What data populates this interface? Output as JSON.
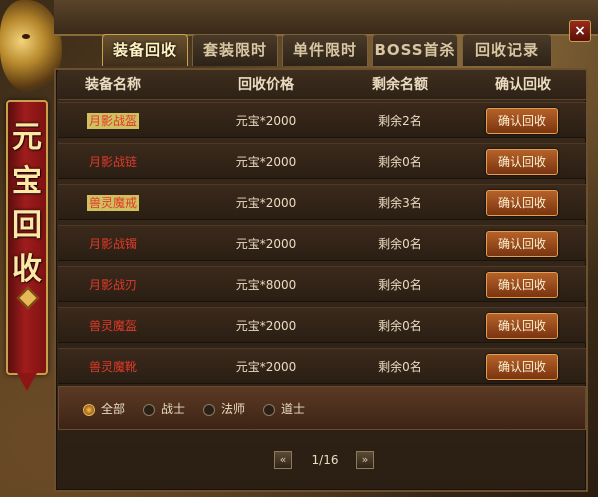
{
  "banner": {
    "title": "元宝回收"
  },
  "tabs": [
    {
      "label": "装备回收"
    },
    {
      "label": "套装限时"
    },
    {
      "label": "单件限时"
    },
    {
      "label": "BOSS首杀"
    },
    {
      "label": "回收记录"
    }
  ],
  "table": {
    "headers": {
      "name": "装备名称",
      "price": "回收价格",
      "remaining": "剩余名额",
      "action": "确认回收"
    },
    "rows": [
      {
        "name": "月影战盔",
        "price": "元宝*2000",
        "remaining": "剩余2名",
        "button": "确认回收",
        "name_style": "hi"
      },
      {
        "name": "月影战链",
        "price": "元宝*2000",
        "remaining": "剩余0名",
        "button": "确认回收",
        "name_style": "red"
      },
      {
        "name": "兽灵魔戒",
        "price": "元宝*2000",
        "remaining": "剩余3名",
        "button": "确认回收",
        "name_style": "hi"
      },
      {
        "name": "月影战镯",
        "price": "元宝*2000",
        "remaining": "剩余0名",
        "button": "确认回收",
        "name_style": "red"
      },
      {
        "name": "月影战刃",
        "price": "元宝*8000",
        "remaining": "剩余0名",
        "button": "确认回收",
        "name_style": "red"
      },
      {
        "name": "兽灵魔盔",
        "price": "元宝*2000",
        "remaining": "剩余0名",
        "button": "确认回收",
        "name_style": "red"
      },
      {
        "name": "兽灵魔靴",
        "price": "元宝*2000",
        "remaining": "剩余0名",
        "button": "确认回收",
        "name_style": "red"
      }
    ]
  },
  "filters": [
    {
      "label": "全部",
      "selected": true
    },
    {
      "label": "战士",
      "selected": false
    },
    {
      "label": "法师",
      "selected": false
    },
    {
      "label": "道士",
      "selected": false
    }
  ],
  "pager": {
    "text": "1/16",
    "prev": "«",
    "next": "»"
  },
  "window": {
    "close": "×"
  }
}
